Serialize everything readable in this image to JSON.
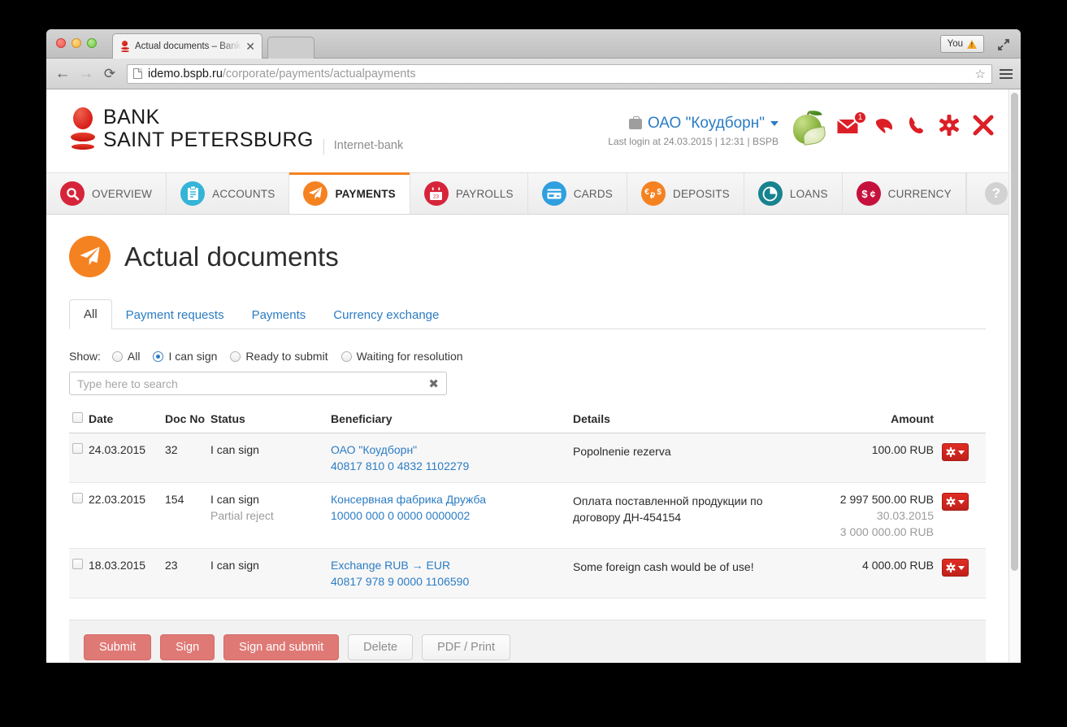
{
  "browser": {
    "tab_title": "Actual documents – Bank S",
    "tab_close": "✕",
    "url_host": "idemo.bspb.ru",
    "url_path": "/corporate/payments/actualpayments",
    "you_label": "You",
    "back_icon": "←",
    "forward_icon": "→",
    "reload_icon": "⟳",
    "star_icon": "☆"
  },
  "bank_header": {
    "logo_line1": "BANK",
    "logo_line2": "SAINT PETERSBURG",
    "logo_sub": "Internet-bank",
    "company_name": "ОАО \"Коудборн\"",
    "last_login": "Last login at 24.03.2015 | 12:31 | BSPB",
    "mail_badge": "1"
  },
  "nav": {
    "items": [
      {
        "label": "OVERVIEW",
        "icon": "search-icon",
        "color": "#d6253a",
        "active": false
      },
      {
        "label": "ACCOUNTS",
        "icon": "clipboard-icon",
        "color": "#35b4d8",
        "active": false
      },
      {
        "label": "PAYMENTS",
        "icon": "paperplane-icon",
        "color": "#f58220",
        "active": true
      },
      {
        "label": "PAYROLLS",
        "icon": "calendar-icon",
        "color": "#d6253a",
        "active": false
      },
      {
        "label": "CARDS",
        "icon": "card-icon",
        "color": "#2f9fe0",
        "active": false
      },
      {
        "label": "DEPOSITS",
        "icon": "currency-icon",
        "color": "#f58220",
        "active": false
      },
      {
        "label": "LOANS",
        "icon": "piechart-icon",
        "color": "#17838f",
        "active": false
      },
      {
        "label": "CURRENCY",
        "icon": "dollar-icon",
        "color": "#c5123c",
        "active": false
      }
    ],
    "help_label": "?"
  },
  "page": {
    "title": "Actual documents",
    "subtabs": [
      {
        "label": "All",
        "active": true
      },
      {
        "label": "Payment requests",
        "active": false
      },
      {
        "label": "Payments",
        "active": false
      },
      {
        "label": "Currency exchange",
        "active": false
      }
    ]
  },
  "filter": {
    "label": "Show:",
    "options": [
      {
        "label": "All",
        "checked": false
      },
      {
        "label": "I can sign",
        "checked": true
      },
      {
        "label": "Ready to submit",
        "checked": false
      },
      {
        "label": "Waiting for resolution",
        "checked": false
      }
    ]
  },
  "search": {
    "value": "",
    "placeholder": "Type here to search",
    "clear_icon": "✖"
  },
  "table": {
    "headers": {
      "date": "Date",
      "doc_no": "Doc No",
      "status": "Status",
      "beneficiary": "Beneficiary",
      "details": "Details",
      "amount": "Amount"
    },
    "rows": [
      {
        "date": "24.03.2015",
        "doc_no": "32",
        "status": "I can sign",
        "status_sub": "",
        "beneficiary_name": "ОАО \"Коудборн\"",
        "beneficiary_account": "40817 810 0 4832 1102279",
        "details": "Popolnenie rezerva",
        "amount": "100.00 RUB",
        "amount_sub1": "",
        "amount_sub2": ""
      },
      {
        "date": "22.03.2015",
        "doc_no": "154",
        "status": "I can sign",
        "status_sub": "Partial reject",
        "beneficiary_name": "Консервная фабрика Дружба",
        "beneficiary_account": "10000 000 0 0000 0000002",
        "details": "Оплата поставленной продукции по договору ДН-454154",
        "amount": "2 997 500.00 RUB",
        "amount_sub1": "30.03.2015",
        "amount_sub2": "3 000 000.00 RUB"
      },
      {
        "date": "18.03.2015",
        "doc_no": "23",
        "status": "I can sign",
        "status_sub": "",
        "beneficiary_name": "Exchange RUB → EUR",
        "beneficiary_account": "40817 978 9 0000 1106590",
        "details": "Some foreign cash would be of use!",
        "amount": "4 000.00 RUB",
        "amount_sub1": "",
        "amount_sub2": ""
      }
    ]
  },
  "actions": {
    "buttons": [
      {
        "label": "Submit",
        "style": "primary"
      },
      {
        "label": "Sign",
        "style": "primary"
      },
      {
        "label": "Sign and submit",
        "style": "primary"
      },
      {
        "label": "Delete",
        "style": "default"
      },
      {
        "label": "PDF / Print",
        "style": "default"
      }
    ]
  },
  "colors": {
    "accent_orange": "#f58220",
    "link_blue": "#2b7cc4",
    "brand_red": "#dc1f26",
    "btn_primary": "#df7975"
  }
}
